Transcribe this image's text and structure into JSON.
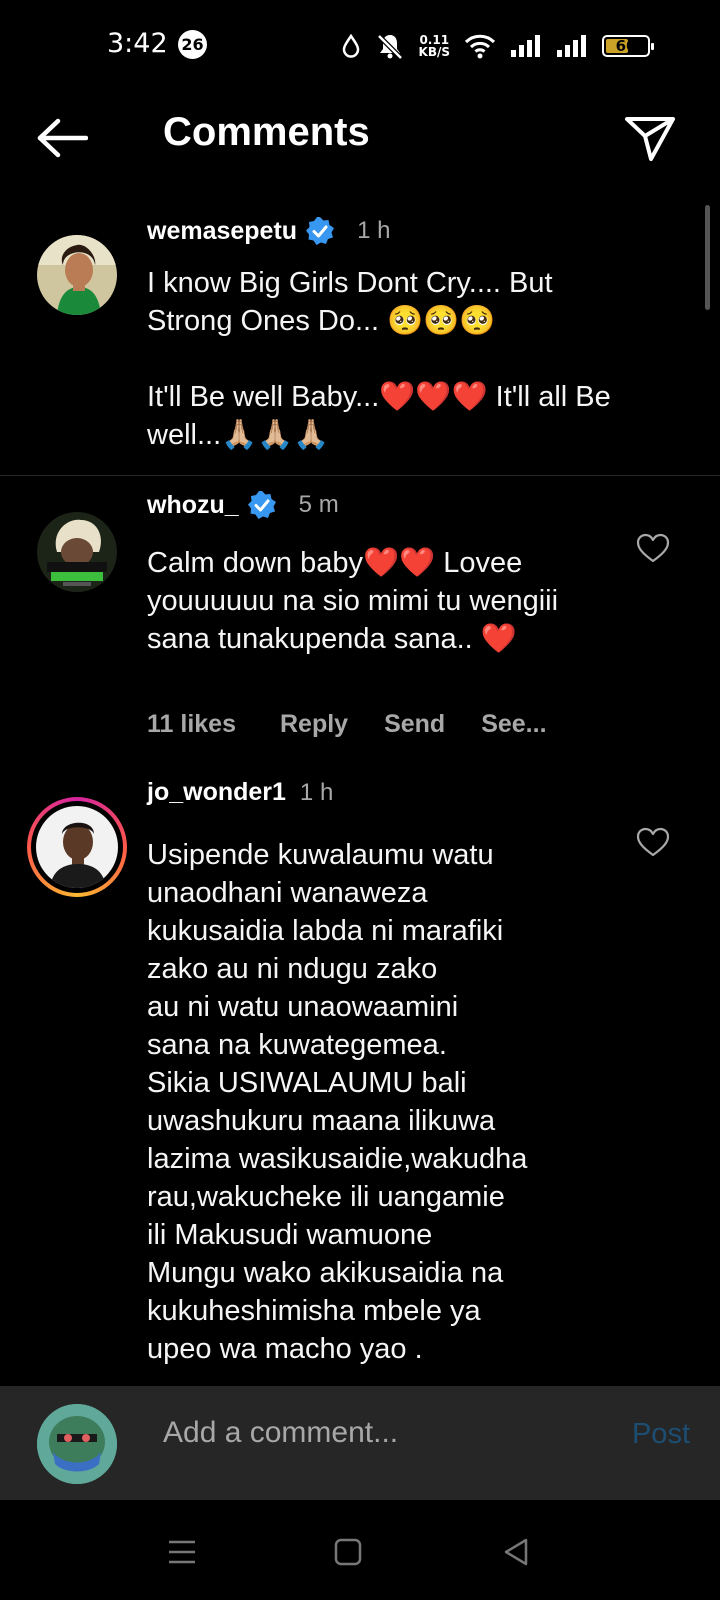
{
  "status_bar": {
    "time": "3:42",
    "notification_count": "26",
    "net_speed_value": "0.11",
    "net_speed_unit": "KB/S",
    "battery": "60",
    "battery_level": 0.6
  },
  "header": {
    "title": "Comments"
  },
  "comments": [
    {
      "username": "wemasepetu",
      "verified": true,
      "time": "1 h",
      "text": "I know Big Girls Dont Cry.... But Strong Ones Do... 🥺🥺🥺\n\nIt'll Be well Baby...❤️❤️❤️ It'll all Be well...🙏🏼🙏🏼🙏🏼"
    },
    {
      "username": "whozu_",
      "verified": true,
      "time": "5 m",
      "text": "Calm down baby❤️❤️ Lovee youuuuuu na sio mimi tu wengiii sana tunakupenda sana.. ❤️",
      "likes": "11 likes",
      "reply": "Reply",
      "send": "Send",
      "see": "See..."
    },
    {
      "username": "jo_wonder1",
      "verified": false,
      "time": "1 h",
      "text": "Usipende kuwalaumu watu\nunaodhani wanaweza\nkukusaidia labda ni marafiki\nzako au ni ndugu zako\nau ni watu unaowaamini\nsana na kuwategemea.\nSikia USIWALAUMU bali\nuwashukuru maana ilikuwa\nlazima wasikusaidie,wakudha\nrau,wakucheke ili uangamie\nili Makusudi wamuone\nMungu wako akikusaidia na\nkukuheshimisha mbele ya\nupeo wa macho yao ."
    }
  ],
  "composer": {
    "placeholder": "Add a comment...",
    "post_label": "Post"
  },
  "colors": {
    "background": "#000000",
    "verified": "#3897f0",
    "muted": "#a8a8a8",
    "post_disabled": "#1c4e74"
  }
}
